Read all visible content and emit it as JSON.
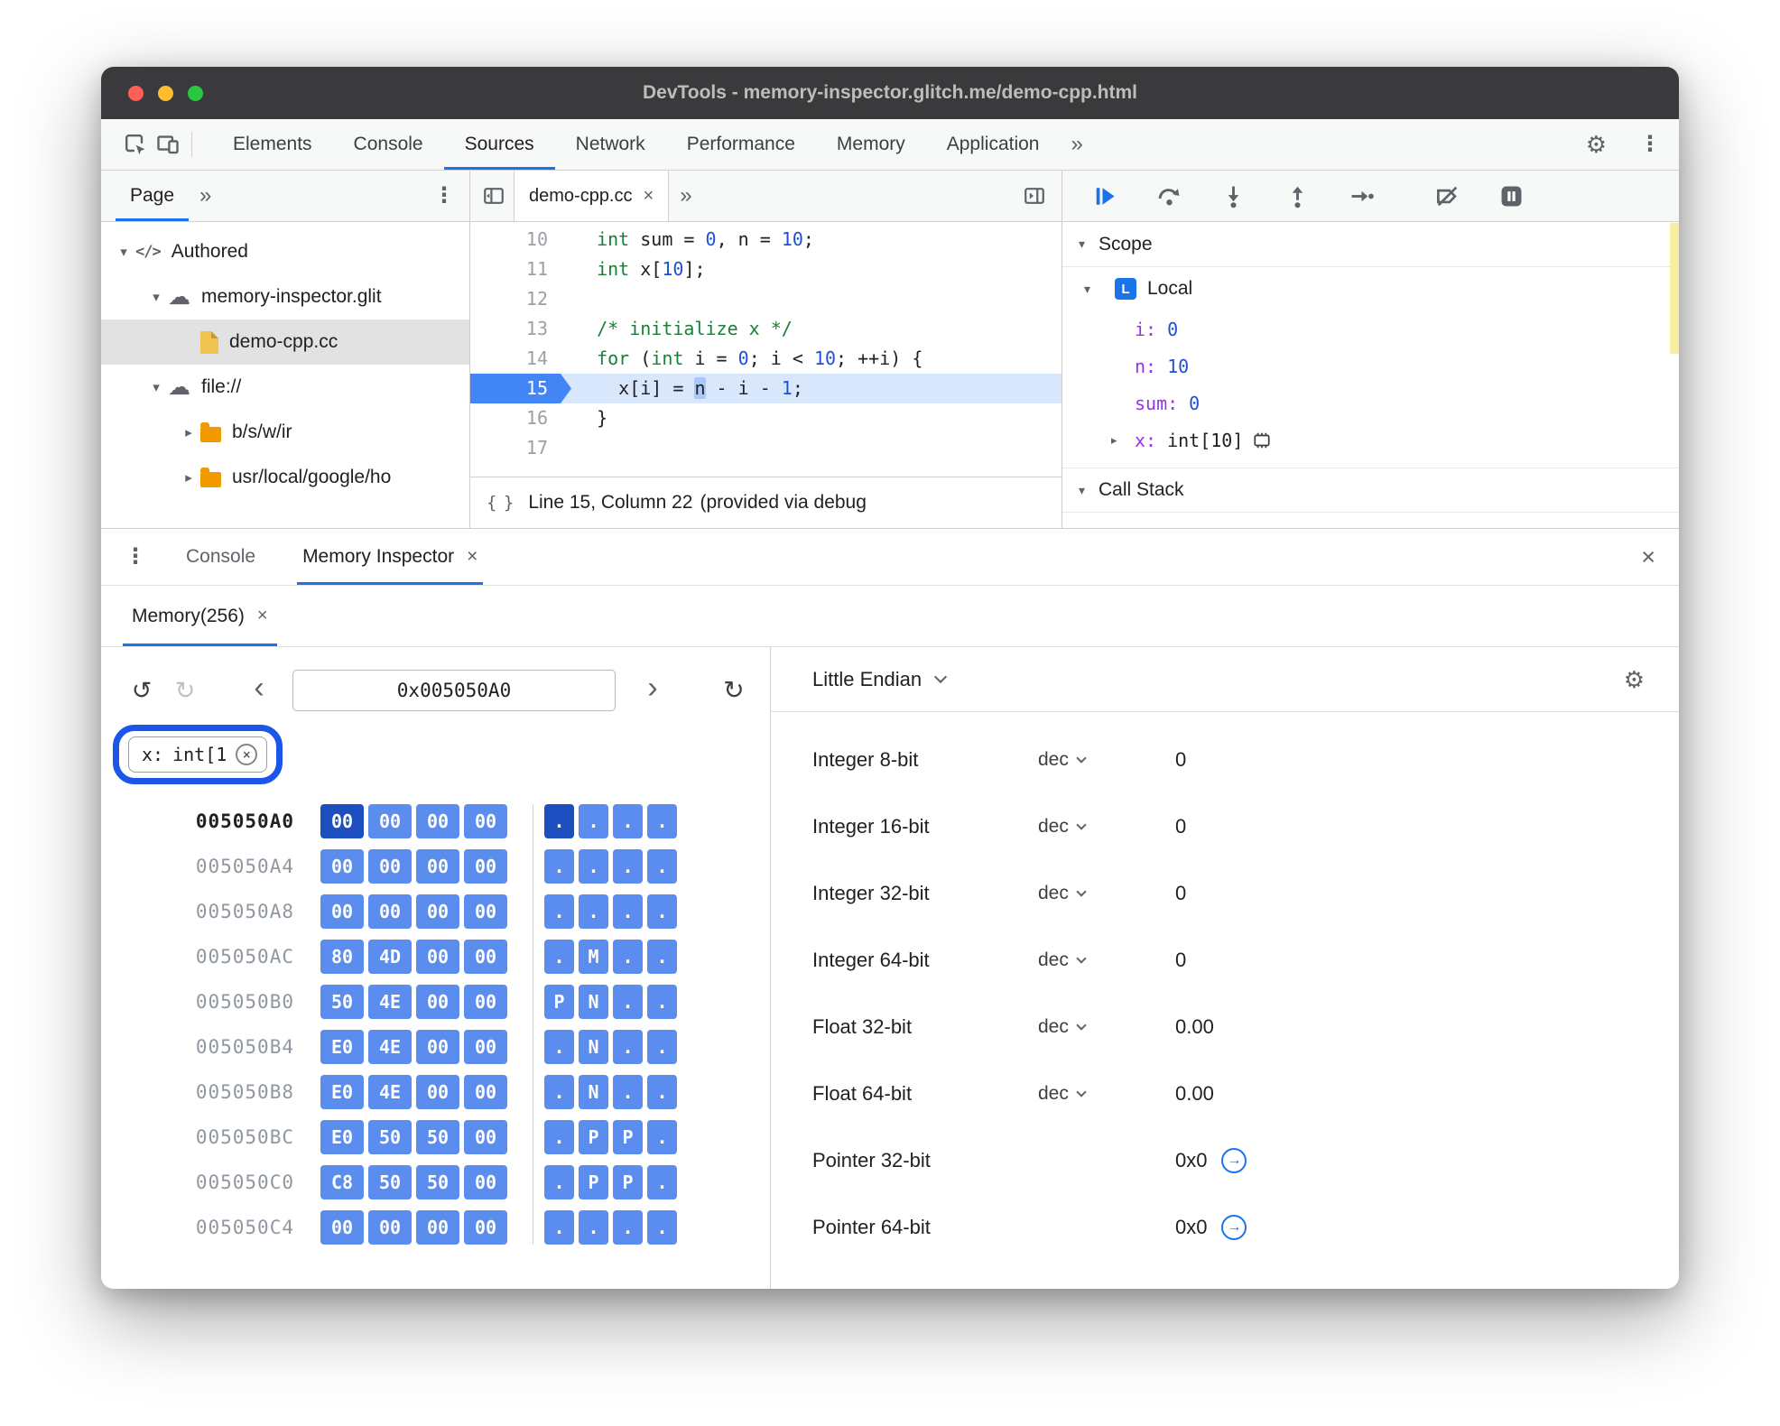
{
  "colors": {
    "accent": "#1a73e8",
    "byte_highlight": "#5b8def",
    "byte_selected": "#1d4fc0",
    "annotation_ring": "#1a56e8",
    "active_line_bg": "#d9e7fd",
    "keyword_green": "#188038",
    "number_blue": "#1f4fd6",
    "variable_purple": "#9334e6",
    "paused_strip_yellow": "#f7ef9f",
    "folder_orange": "#f29900",
    "file_yellow": "#f0c24f",
    "titlebar_gray": "#3a3a3c"
  },
  "icons": {
    "settings_gear": "⚙",
    "overflow_menu": "⋮",
    "close": "×",
    "more_tabs": "»",
    "cloud": "☁",
    "code": "</>",
    "undo": "↺",
    "redo": "↻",
    "back": "‹",
    "forward": "›",
    "refresh": "↻",
    "triangle_down": "▾",
    "triangle_right": "▸",
    "jump_arrow": "→",
    "braces": "{ }"
  },
  "window": {
    "title": "DevTools - memory-inspector.glitch.me/demo-cpp.html"
  },
  "main_toolbar": {
    "tabs": [
      "Elements",
      "Console",
      "Sources",
      "Network",
      "Performance",
      "Memory",
      "Application"
    ],
    "active_tab": "Sources"
  },
  "navigator": {
    "tab": "Page",
    "tree": [
      {
        "label": "Authored",
        "icon": "code-icon",
        "expanded": true,
        "indent": 0,
        "selected": false
      },
      {
        "label": "memory-inspector.glit",
        "icon": "cloud-icon",
        "expanded": true,
        "indent": 1,
        "selected": false
      },
      {
        "label": "demo-cpp.cc",
        "icon": "file-icon",
        "expanded": null,
        "indent": 2,
        "selected": true
      },
      {
        "label": "file://",
        "icon": "cloud-icon",
        "expanded": true,
        "indent": 1,
        "selected": false
      },
      {
        "label": "b/s/w/ir",
        "icon": "folder-icon",
        "expanded": false,
        "indent": 2,
        "selected": false
      },
      {
        "label": "usr/local/google/ho",
        "icon": "folder-icon",
        "expanded": false,
        "indent": 2,
        "selected": false
      }
    ]
  },
  "editor": {
    "tab": "demo-cpp.cc",
    "active_line": 15,
    "lines": [
      {
        "num": 10,
        "segs": [
          [
            "  ",
            ""
          ],
          [
            "int",
            "kw"
          ],
          [
            " sum = ",
            ""
          ],
          [
            "0",
            "num"
          ],
          [
            ", n = ",
            ""
          ],
          [
            "10",
            "num"
          ],
          [
            ";",
            ""
          ]
        ]
      },
      {
        "num": 11,
        "segs": [
          [
            "  ",
            ""
          ],
          [
            "int",
            "kw"
          ],
          [
            " x[",
            ""
          ],
          [
            "10",
            "num"
          ],
          [
            "];",
            ""
          ]
        ]
      },
      {
        "num": 12,
        "segs": []
      },
      {
        "num": 13,
        "segs": [
          [
            "  ",
            ""
          ],
          [
            "/* initialize x */",
            "com"
          ]
        ]
      },
      {
        "num": 14,
        "segs": [
          [
            "  ",
            ""
          ],
          [
            "for",
            "kw"
          ],
          [
            " (",
            ""
          ],
          [
            "int",
            "kw"
          ],
          [
            " i = ",
            ""
          ],
          [
            "0",
            "num"
          ],
          [
            "; i < ",
            ""
          ],
          [
            "10",
            "num"
          ],
          [
            "; ++i) {",
            ""
          ]
        ]
      },
      {
        "num": 15,
        "segs": [
          [
            "    x[i] = ",
            ""
          ],
          [
            "n",
            "sel"
          ],
          [
            " - i - ",
            ""
          ],
          [
            "1",
            "num"
          ],
          [
            ";",
            ""
          ]
        ]
      },
      {
        "num": 16,
        "segs": [
          [
            "  }",
            ""
          ]
        ]
      },
      {
        "num": 17,
        "segs": []
      }
    ],
    "status_position": "Line 15, Column 22",
    "status_note": "(provided via debug"
  },
  "debugger": {
    "scope_title": "Scope",
    "call_stack_title": "Call Stack",
    "local_badge": "L",
    "local_label": "Local",
    "variables": [
      {
        "name": "i",
        "value": "0",
        "kind": "num",
        "expandable": false,
        "memory_icon": false
      },
      {
        "name": "n",
        "value": "10",
        "kind": "num",
        "expandable": false,
        "memory_icon": false
      },
      {
        "name": "sum",
        "value": "0",
        "kind": "num",
        "expandable": false,
        "memory_icon": false
      },
      {
        "name": "x",
        "value": "int[10]",
        "kind": "obj",
        "expandable": true,
        "memory_icon": true
      }
    ]
  },
  "drawer": {
    "console_tab": "Console",
    "memory_inspector_tab": "Memory Inspector",
    "memory_view_tab": "Memory(256)"
  },
  "inspector": {
    "address": "0x005050A0",
    "chip_name": "x:",
    "chip_type": "int[1",
    "endianness": "Little Endian",
    "rows": [
      {
        "addr": "005050A0",
        "bytes": [
          "00",
          "00",
          "00",
          "00"
        ],
        "ascii": [
          ".",
          ".",
          ".",
          "."
        ],
        "selected_byte": 0
      },
      {
        "addr": "005050A4",
        "bytes": [
          "00",
          "00",
          "00",
          "00"
        ],
        "ascii": [
          ".",
          ".",
          ".",
          "."
        ],
        "selected_byte": null
      },
      {
        "addr": "005050A8",
        "bytes": [
          "00",
          "00",
          "00",
          "00"
        ],
        "ascii": [
          ".",
          ".",
          ".",
          "."
        ],
        "selected_byte": null
      },
      {
        "addr": "005050AC",
        "bytes": [
          "80",
          "4D",
          "00",
          "00"
        ],
        "ascii": [
          ".",
          "M",
          ".",
          "."
        ],
        "selected_byte": null
      },
      {
        "addr": "005050B0",
        "bytes": [
          "50",
          "4E",
          "00",
          "00"
        ],
        "ascii": [
          "P",
          "N",
          ".",
          "."
        ],
        "selected_byte": null
      },
      {
        "addr": "005050B4",
        "bytes": [
          "E0",
          "4E",
          "00",
          "00"
        ],
        "ascii": [
          ".",
          "N",
          ".",
          "."
        ],
        "selected_byte": null
      },
      {
        "addr": "005050B8",
        "bytes": [
          "E0",
          "4E",
          "00",
          "00"
        ],
        "ascii": [
          ".",
          "N",
          ".",
          "."
        ],
        "selected_byte": null
      },
      {
        "addr": "005050BC",
        "bytes": [
          "E0",
          "50",
          "50",
          "00"
        ],
        "ascii": [
          ".",
          "P",
          "P",
          "."
        ],
        "selected_byte": null
      },
      {
        "addr": "005050C0",
        "bytes": [
          "C8",
          "50",
          "50",
          "00"
        ],
        "ascii": [
          ".",
          "P",
          "P",
          "."
        ],
        "selected_byte": null
      },
      {
        "addr": "005050C4",
        "bytes": [
          "00",
          "00",
          "00",
          "00"
        ],
        "ascii": [
          ".",
          ".",
          ".",
          "."
        ],
        "selected_byte": null
      }
    ],
    "interpretations": [
      {
        "label": "Integer 8-bit",
        "mode": "dec",
        "value": "0",
        "jump": false
      },
      {
        "label": "Integer 16-bit",
        "mode": "dec",
        "value": "0",
        "jump": false
      },
      {
        "label": "Integer 32-bit",
        "mode": "dec",
        "value": "0",
        "jump": false
      },
      {
        "label": "Integer 64-bit",
        "mode": "dec",
        "value": "0",
        "jump": false
      },
      {
        "label": "Float 32-bit",
        "mode": "dec",
        "value": "0.00",
        "jump": false
      },
      {
        "label": "Float 64-bit",
        "mode": "dec",
        "value": "0.00",
        "jump": false
      },
      {
        "label": "Pointer 32-bit",
        "mode": null,
        "value": "0x0",
        "jump": true
      },
      {
        "label": "Pointer 64-bit",
        "mode": null,
        "value": "0x0",
        "jump": true
      }
    ]
  }
}
